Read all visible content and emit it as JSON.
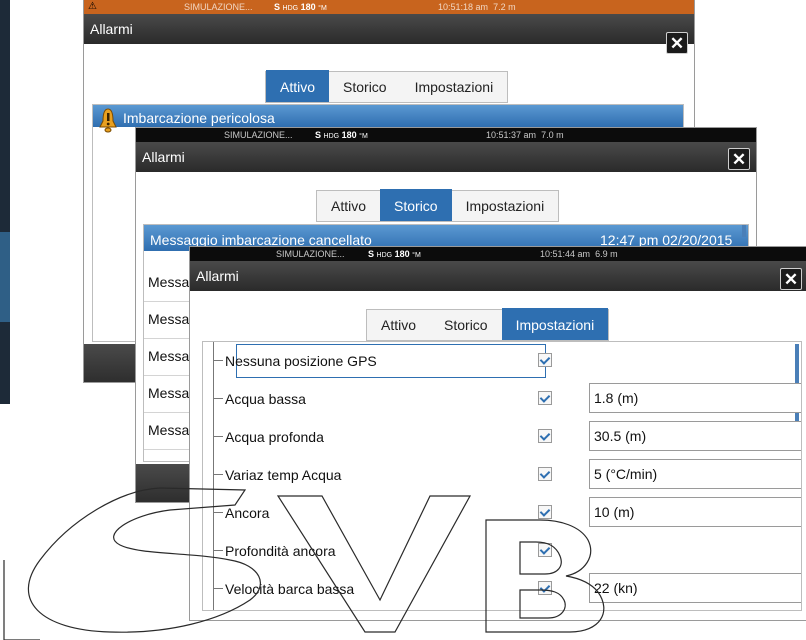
{
  "colors": {
    "accent": "#2e6fb1",
    "statusbar_bg": "#0c0c0c",
    "orange_status": "#c8641e"
  },
  "window_back": {
    "status": {
      "sim": "SIMULAZIONE...",
      "hdg_s": "S",
      "hdg_label": "HDG",
      "hdg_value": "180",
      "hdg_unit": "°M",
      "time": "10:51:18 am",
      "depth": "7.2 m"
    },
    "title": "Allarmi",
    "tabs": [
      "Attivo",
      "Storico",
      "Impostazioni"
    ],
    "active_tab": "Attivo",
    "alarm_row": "Imbarcazione pericolosa"
  },
  "window_mid": {
    "status": {
      "sim": "SIMULAZIONE...",
      "hdg_s": "S",
      "hdg_label": "HDG",
      "hdg_value": "180",
      "hdg_unit": "°M",
      "time": "10:51:37 am",
      "depth": "7.0 m"
    },
    "title": "Allarmi",
    "tabs": [
      "Attivo",
      "Storico",
      "Impostazioni"
    ],
    "active_tab": "Storico",
    "selected_row": {
      "text": "Messaggio imbarcazione cancellato",
      "time": "12:47 pm 02/20/2015"
    },
    "rows": [
      "Messa",
      "Messa",
      "Messa",
      "Messa",
      "Messa"
    ]
  },
  "window_front": {
    "status": {
      "sim": "SIMULAZIONE...",
      "hdg_s": "S",
      "hdg_label": "HDG",
      "hdg_value": "180",
      "hdg_unit": "°M",
      "time": "10:51:44 am",
      "depth": "6.9 m"
    },
    "title": "Allarmi",
    "tabs": [
      "Attivo",
      "Storico",
      "Impostazioni"
    ],
    "active_tab": "Impostazioni",
    "settings": [
      {
        "label": "Nessuna posizione GPS",
        "value": ""
      },
      {
        "label": "Acqua bassa",
        "value": "1.8 (m)"
      },
      {
        "label": "Acqua profonda",
        "value": "30.5 (m)"
      },
      {
        "label": "Variaz temp Acqua",
        "value": "5 (°C/min)"
      },
      {
        "label": "Ancora",
        "value": "10 (m)"
      },
      {
        "label": "Profondità ancora",
        "value": ""
      },
      {
        "label": "Velocità barca bassa",
        "value": "22 (kn)"
      }
    ]
  },
  "icons": {
    "close": "close-icon",
    "warning": "warning-icon",
    "check": "checkbox-checked-icon"
  }
}
